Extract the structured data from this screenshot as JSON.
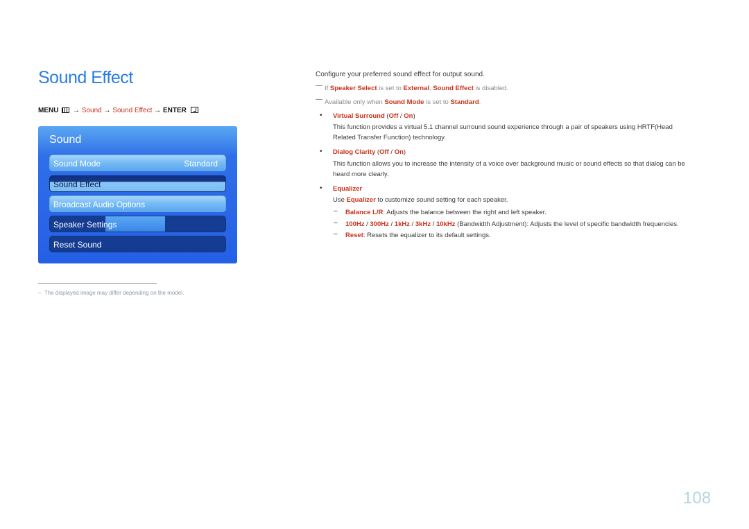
{
  "page_title": "Sound Effect",
  "menu_path": {
    "menu": "MENU",
    "menu_icon": "menu-grid-icon",
    "arrow": "→",
    "step1": "Sound",
    "step2": "Sound Effect",
    "enter": "ENTER",
    "enter_icon": "enter-return-icon"
  },
  "osd": {
    "title": "Sound",
    "items": [
      {
        "label": "Sound Mode",
        "value": "Standard",
        "state": "normal"
      },
      {
        "label": "Sound Effect",
        "value": "",
        "state": "selected"
      },
      {
        "label": "Broadcast Audio Options",
        "value": "",
        "state": "normal"
      },
      {
        "label": "Speaker Settings",
        "value": "",
        "state": "dark"
      },
      {
        "label": "Reset Sound",
        "value": "",
        "state": "dark"
      }
    ]
  },
  "footnote": "The displayed image may differ depending on the model.",
  "footnote_dash": "–",
  "content": {
    "intro": "Configure your preferred sound effect for output sound.",
    "note1": {
      "pre": "If ",
      "k1": "Speaker Select",
      "mid1": " is set to ",
      "k2": "External",
      "mid2": ", ",
      "k3": "Sound Effect",
      "post": " is disabled."
    },
    "note2": {
      "pre": "Available only when ",
      "k1": "Sound Mode",
      "mid1": " is set to ",
      "k2": "Standard",
      "post": "."
    },
    "bullet": "•",
    "virtual_surround": {
      "title": "Virtual Surround",
      "open": " (",
      "off": "Off",
      "sep": " / ",
      "on": "On",
      "close": ")",
      "desc1": "This function provides a virtual 5.1 channel surround sound experience through a pair of speakers using HRTF(Head",
      "desc2": "Related Transfer Function) technology."
    },
    "dialog_clarity": {
      "title": "Dialog Clarity",
      "open": " (",
      "off": "Off",
      "sep": " / ",
      "on": "On",
      "close": ")",
      "desc1": "This function allows you to increase the intensity of a voice over background music or sound effects so that dialog can be",
      "desc2": "heard more clearly."
    },
    "equalizer": {
      "title": "Equalizer",
      "use_pre": "Use ",
      "use_key": "Equalizer",
      "use_post": " to customize sound setting for each speaker.",
      "dash": "–",
      "balance_key": "Balance L/R",
      "balance_text": ": Adjusts the balance between the right and left speaker.",
      "bands": [
        "100Hz",
        "300Hz",
        "1kHz",
        "3kHz",
        "10kHz"
      ],
      "band_sep": " / ",
      "bands_text": " (Bandwidth Adjustment): Adjusts the level of specific bandwidth frequencies.",
      "reset_key": "Reset",
      "reset_text": ": Resets the equalizer to its default settings."
    }
  },
  "page_number": "108"
}
